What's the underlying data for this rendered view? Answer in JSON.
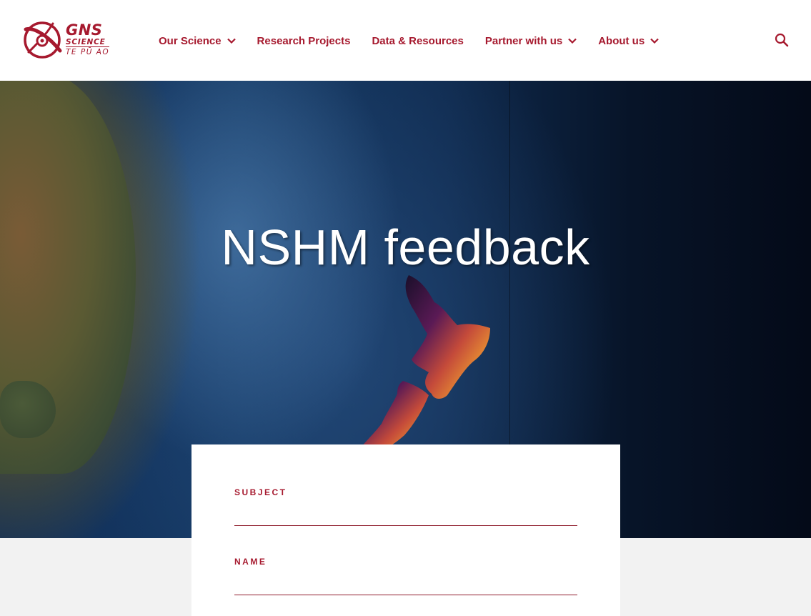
{
  "brand": {
    "name": "GNS",
    "line2": "SCIENCE",
    "line3": "TE PŪ AO",
    "color": "#a6192e"
  },
  "nav": {
    "items": [
      {
        "label": "Our Science",
        "has_dropdown": true
      },
      {
        "label": "Research Projects",
        "has_dropdown": false
      },
      {
        "label": "Data & Resources",
        "has_dropdown": false
      },
      {
        "label": "Partner with us",
        "has_dropdown": true
      },
      {
        "label": "About us",
        "has_dropdown": true
      }
    ],
    "search_icon": "search-icon",
    "dropdown_icon": "chevron-down-icon"
  },
  "hero": {
    "title": "NSHM feedback"
  },
  "form": {
    "subject": {
      "label": "SUBJECT",
      "value": "",
      "placeholder": ""
    },
    "name": {
      "label": "NAME",
      "value": "",
      "placeholder": ""
    }
  }
}
